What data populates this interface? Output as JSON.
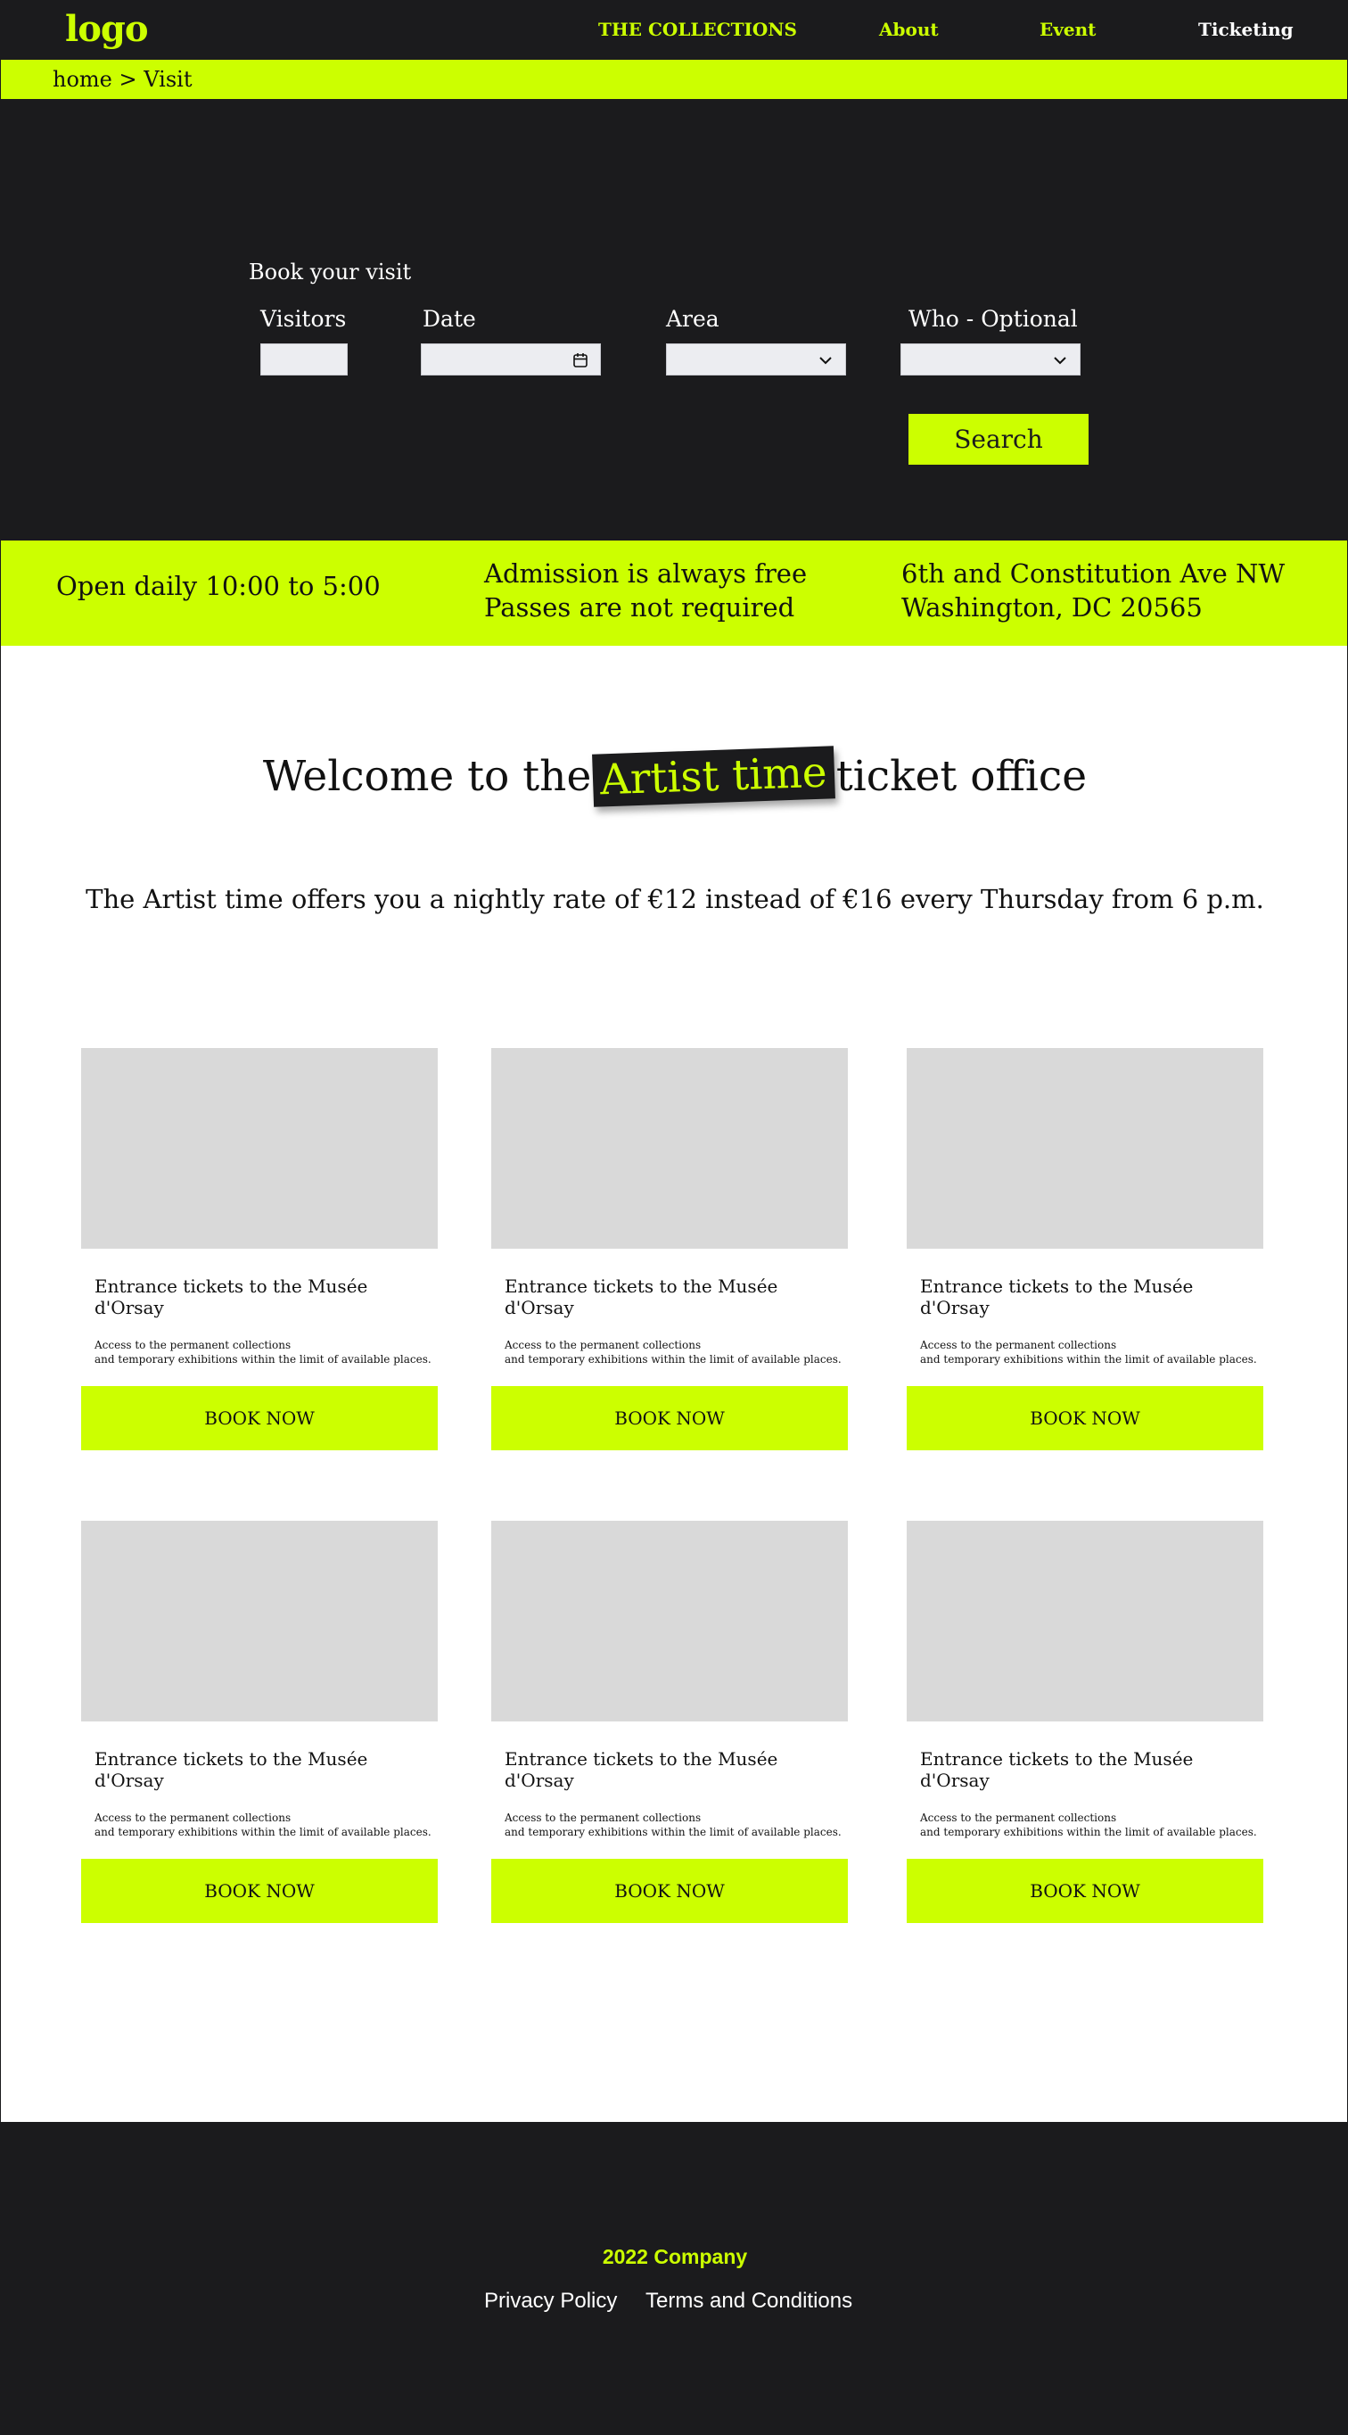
{
  "nav": {
    "logo": "logo",
    "links": [
      "THE COLLECTIONS",
      "About",
      "Event",
      "Ticketing"
    ]
  },
  "breadcrumb": "home > Visit",
  "booking": {
    "heading": "Book your visit",
    "labels": [
      "Visitors",
      "Date",
      "Area",
      "Who - Optional"
    ],
    "visitors_value": "",
    "date_value": "",
    "area_value": "",
    "who_value": "",
    "search_label": "Search"
  },
  "info": {
    "hours": "Open daily 10:00 to 5:00",
    "admission_line1": "Admission is always free",
    "admission_line2": "Passes are not required",
    "address_line1": "6th and Constitution Ave NW",
    "address_line2": "Washington, DC 20565"
  },
  "welcome": {
    "before": "Welcome to the",
    "highlight": "Artist time",
    "after": "ticket office",
    "offer": "The Artist time offers you a nightly rate of €12 instead of €16 every Thursday from 6 p.m."
  },
  "cards": [
    {
      "title": "Entrance tickets to the Musée d'Orsay",
      "desc1": "Access to the permanent collections",
      "desc2": "and temporary exhibitions within the limit of available places.",
      "button": "BOOK NOW"
    },
    {
      "title": "Entrance tickets to the Musée d'Orsay",
      "desc1": "Access to the permanent collections",
      "desc2": "and temporary exhibitions within the limit of available places.",
      "button": "BOOK NOW"
    },
    {
      "title": "Entrance tickets to the Musée d'Orsay",
      "desc1": "Access to the permanent collections",
      "desc2": "and temporary exhibitions within the limit of available places.",
      "button": "BOOK NOW"
    },
    {
      "title": "Entrance tickets to the Musée d'Orsay",
      "desc1": "Access to the permanent collections",
      "desc2": "and temporary exhibitions within the limit of available places.",
      "button": "BOOK NOW"
    },
    {
      "title": "Entrance tickets to the Musée d'Orsay",
      "desc1": "Access to the permanent collections",
      "desc2": "and temporary exhibitions within the limit of available places.",
      "button": "BOOK NOW"
    },
    {
      "title": "Entrance tickets to the Musée d'Orsay",
      "desc1": "Access to the permanent collections",
      "desc2": "and temporary exhibitions within the limit of available places.",
      "button": "BOOK NOW"
    }
  ],
  "footer": {
    "company": "2022 Company",
    "links": [
      "Privacy Policy",
      "Terms and Conditions"
    ]
  },
  "colors": {
    "accent": "#ccff00",
    "dark": "#1b1b1d",
    "placeholder": "#d9d9d9",
    "field": "#ecedf1"
  },
  "icons": [
    "calendar-icon",
    "chevron-down-icon"
  ]
}
